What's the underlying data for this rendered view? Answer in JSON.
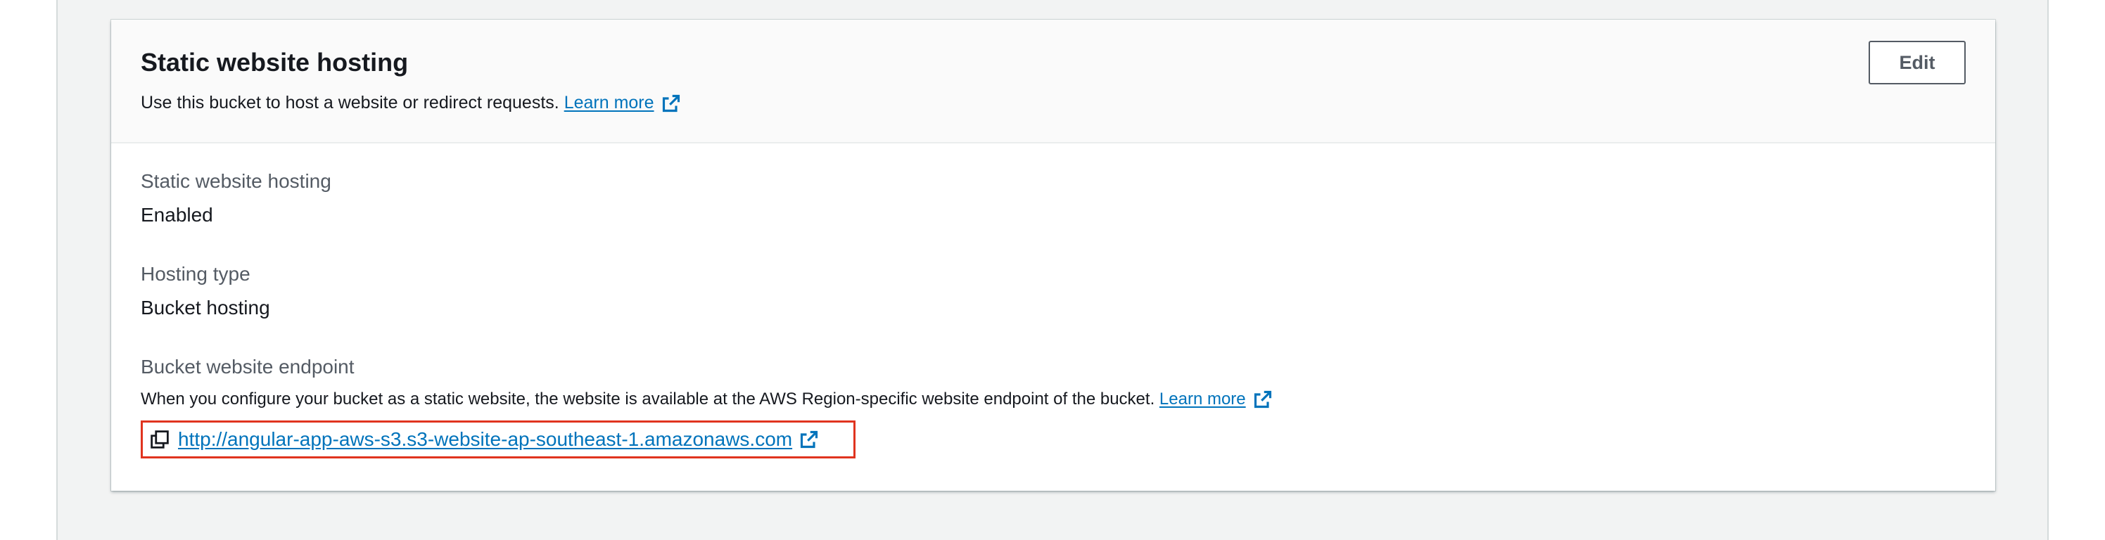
{
  "panel": {
    "title": "Static website hosting",
    "description": "Use this bucket to host a website or redirect requests.",
    "learn_more": "Learn more",
    "edit_label": "Edit"
  },
  "fields": {
    "hosting_status": {
      "label": "Static website hosting",
      "value": "Enabled"
    },
    "hosting_type": {
      "label": "Hosting type",
      "value": "Bucket hosting"
    },
    "endpoint": {
      "label": "Bucket website endpoint",
      "description": "When you configure your bucket as a static website, the website is available at the AWS Region-specific website endpoint of the bucket.",
      "learn_more": "Learn more",
      "url": "http://angular-app-aws-s3.s3-website-ap-southeast-1.amazonaws.com"
    }
  },
  "icons": {
    "external_link": "external-link-icon",
    "copy": "copy-icon"
  },
  "colors": {
    "link": "#0073bb",
    "highlight_border": "#e0341f",
    "page_background": "#f2f3f3"
  }
}
